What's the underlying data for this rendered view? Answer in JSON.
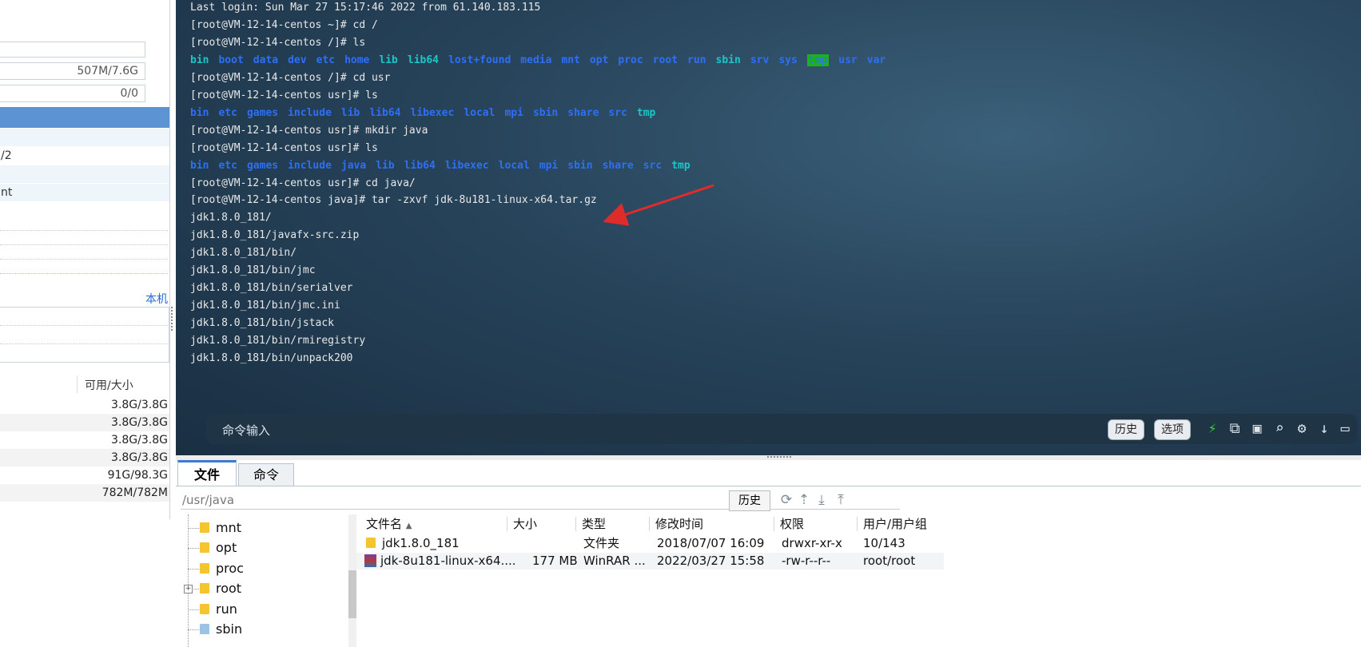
{
  "left_panel": {
    "mem_value": "507M/7.6G",
    "swap_value": "0/0",
    "rows": [
      "",
      "/2",
      "",
      "nt"
    ],
    "local_link": "本机",
    "disk_header": "可用/大小",
    "disks": [
      "3.8G/3.8G",
      "3.8G/3.8G",
      "3.8G/3.8G",
      "3.8G/3.8G",
      "91G/98.3G",
      "782M/782M"
    ]
  },
  "terminal": {
    "lines": [
      {
        "type": "text",
        "text": "Last login: Sun Mar 27 15:17:46 2022 from 61.140.183.115"
      },
      {
        "type": "text",
        "text": "[root@VM-12-14-centos ~]# cd /"
      },
      {
        "type": "text",
        "text": "[root@VM-12-14-centos /]# ls"
      },
      {
        "type": "ls",
        "items": [
          {
            "name": "bin",
            "c": "dirc"
          },
          {
            "name": "boot",
            "c": "dir"
          },
          {
            "name": "data",
            "c": "dir"
          },
          {
            "name": "dev",
            "c": "dir"
          },
          {
            "name": "etc",
            "c": "dir"
          },
          {
            "name": "home",
            "c": "dir"
          },
          {
            "name": "lib",
            "c": "dirc"
          },
          {
            "name": "lib64",
            "c": "dirc"
          },
          {
            "name": "lost+found",
            "c": "dir"
          },
          {
            "name": "media",
            "c": "dir"
          },
          {
            "name": "mnt",
            "c": "dir"
          },
          {
            "name": "opt",
            "c": "dir"
          },
          {
            "name": "proc",
            "c": "dir"
          },
          {
            "name": "root",
            "c": "dir"
          },
          {
            "name": "run",
            "c": "dir"
          },
          {
            "name": "sbin",
            "c": "dirc"
          },
          {
            "name": "srv",
            "c": "dir"
          },
          {
            "name": "sys",
            "c": "dir"
          },
          {
            "name": "tmp",
            "c": "hl"
          },
          {
            "name": "usr",
            "c": "dir"
          },
          {
            "name": "var",
            "c": "dir"
          }
        ]
      },
      {
        "type": "text",
        "text": "[root@VM-12-14-centos /]# cd usr"
      },
      {
        "type": "text",
        "text": "[root@VM-12-14-centos usr]# ls"
      },
      {
        "type": "ls",
        "items": [
          {
            "name": "bin",
            "c": "dir"
          },
          {
            "name": "etc",
            "c": "dir"
          },
          {
            "name": "games",
            "c": "dir"
          },
          {
            "name": "include",
            "c": "dir"
          },
          {
            "name": "lib",
            "c": "dir"
          },
          {
            "name": "lib64",
            "c": "dir"
          },
          {
            "name": "libexec",
            "c": "dir"
          },
          {
            "name": "local",
            "c": "dir"
          },
          {
            "name": "mpi",
            "c": "dir"
          },
          {
            "name": "sbin",
            "c": "dir"
          },
          {
            "name": "share",
            "c": "dir"
          },
          {
            "name": "src",
            "c": "dir"
          },
          {
            "name": "tmp",
            "c": "dirc"
          }
        ]
      },
      {
        "type": "text",
        "text": "[root@VM-12-14-centos usr]# mkdir java"
      },
      {
        "type": "text",
        "text": "[root@VM-12-14-centos usr]# ls"
      },
      {
        "type": "ls",
        "items": [
          {
            "name": "bin",
            "c": "dir"
          },
          {
            "name": "etc",
            "c": "dir"
          },
          {
            "name": "games",
            "c": "dir"
          },
          {
            "name": "include",
            "c": "dir"
          },
          {
            "name": "java",
            "c": "dir"
          },
          {
            "name": "lib",
            "c": "dir"
          },
          {
            "name": "lib64",
            "c": "dir"
          },
          {
            "name": "libexec",
            "c": "dir"
          },
          {
            "name": "local",
            "c": "dir"
          },
          {
            "name": "mpi",
            "c": "dir"
          },
          {
            "name": "sbin",
            "c": "dir"
          },
          {
            "name": "share",
            "c": "dir"
          },
          {
            "name": "src",
            "c": "dir"
          },
          {
            "name": "tmp",
            "c": "dirc"
          }
        ]
      },
      {
        "type": "text",
        "text": "[root@VM-12-14-centos usr]# cd java/"
      },
      {
        "type": "text",
        "text": "[root@VM-12-14-centos java]# tar -zxvf jdk-8u181-linux-x64.tar.gz"
      },
      {
        "type": "text",
        "text": "jdk1.8.0_181/"
      },
      {
        "type": "text",
        "text": "jdk1.8.0_181/javafx-src.zip"
      },
      {
        "type": "text",
        "text": "jdk1.8.0_181/bin/"
      },
      {
        "type": "text",
        "text": "jdk1.8.0_181/bin/jmc"
      },
      {
        "type": "text",
        "text": "jdk1.8.0_181/bin/serialver"
      },
      {
        "type": "text",
        "text": "jdk1.8.0_181/bin/jmc.ini"
      },
      {
        "type": "text",
        "text": "jdk1.8.0_181/bin/jstack"
      },
      {
        "type": "text",
        "text": "jdk1.8.0_181/bin/rmiregistry"
      },
      {
        "type": "text",
        "text": "jdk1.8.0_181/bin/unpack200"
      }
    ],
    "cmd_placeholder": "命令输入",
    "history_btn": "历史",
    "options_btn": "选项",
    "icons": [
      "lightning-icon",
      "copy-icon",
      "paste-icon",
      "search-icon",
      "gear-icon",
      "download-icon",
      "maximize-icon"
    ],
    "arrow_color": "#e02b2b"
  },
  "tabs": {
    "files": "文件",
    "commands": "命令"
  },
  "path": {
    "value": "/usr/java",
    "history_btn": "历史"
  },
  "tree": {
    "items": [
      "mnt",
      "opt",
      "proc",
      "root",
      "run",
      "sbin"
    ]
  },
  "files": {
    "headers": {
      "name": "文件名",
      "size": "大小",
      "type": "类型",
      "mtime": "修改时间",
      "perm": "权限",
      "owner": "用户/用户组"
    },
    "rows": [
      {
        "name": "jdk1.8.0_181",
        "size": "",
        "type": "文件夹",
        "mtime": "2018/07/07 16:09",
        "perm": "drwxr-xr-x",
        "owner": "10/143",
        "icon": "folder-icon"
      },
      {
        "name": "jdk-8u181-linux-x64....",
        "size": "177 MB",
        "type": "WinRAR ...",
        "mtime": "2022/03/27 15:58",
        "perm": "-rw-r--r--",
        "owner": "root/root",
        "icon": "winrar-icon"
      }
    ]
  }
}
